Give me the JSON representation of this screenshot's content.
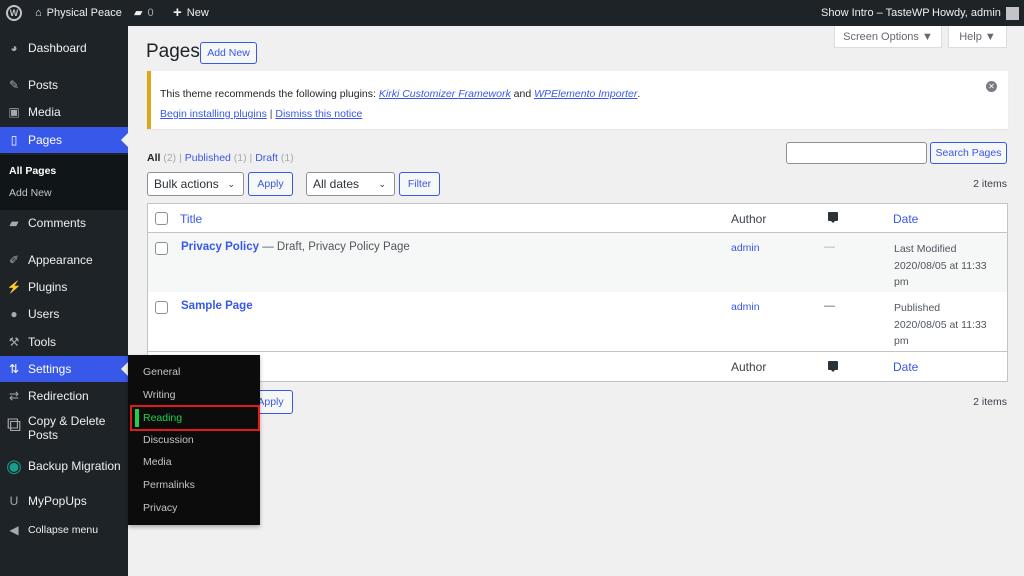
{
  "adminbar": {
    "site": "Physical Peace",
    "comments": "0",
    "new": "New",
    "intro": "Show Intro – TasteWP",
    "howdy": "Howdy, admin"
  },
  "sidebar": {
    "items": [
      "Dashboard",
      "Posts",
      "Media",
      "Pages",
      "Comments",
      "Appearance",
      "Plugins",
      "Users",
      "Tools",
      "Settings",
      "Redirection",
      "Copy & Delete Posts",
      "Backup Migration",
      "MyPopUps",
      "Collapse menu"
    ],
    "pages_sub": [
      "All Pages",
      "Add New"
    ],
    "settings_flyout": [
      "General",
      "Writing",
      "Reading",
      "Discussion",
      "Media",
      "Permalinks",
      "Privacy"
    ]
  },
  "header": {
    "title": "Pages",
    "add_new": "Add New",
    "screen_options": "Screen Options ▼",
    "help": "Help ▼"
  },
  "notice": {
    "text": "This theme recommends the following plugins: ",
    "plugin1": "Kirki Customizer Framework",
    "and": " and ",
    "plugin2": "WPElemento Importer",
    "end": ".",
    "begin": "Begin installing plugins",
    "sep": " | ",
    "dismiss": "Dismiss this notice"
  },
  "views": {
    "all": "All",
    "all_count": "(2)",
    "published": "Published",
    "published_count": "(1)",
    "draft": "Draft",
    "draft_count": "(1)"
  },
  "search": {
    "value": "",
    "button": "Search Pages"
  },
  "filters": {
    "bulk": "Bulk actions",
    "apply": "Apply",
    "dates": "All dates",
    "filter": "Filter",
    "count": "2 items"
  },
  "table": {
    "headers": {
      "title": "Title",
      "author": "Author",
      "date": "Date"
    },
    "rows": [
      {
        "title": "Privacy Policy",
        "state": " — Draft, Privacy Policy Page",
        "author": "admin",
        "comments": "—",
        "status": "Last Modified",
        "date": "2020/08/05 at 11:33",
        "time": "pm"
      },
      {
        "title": "Sample Page",
        "state": "",
        "author": "admin",
        "comments": "—",
        "status": "Published",
        "date": "2020/08/05 at 11:33",
        "time": "pm"
      }
    ]
  }
}
